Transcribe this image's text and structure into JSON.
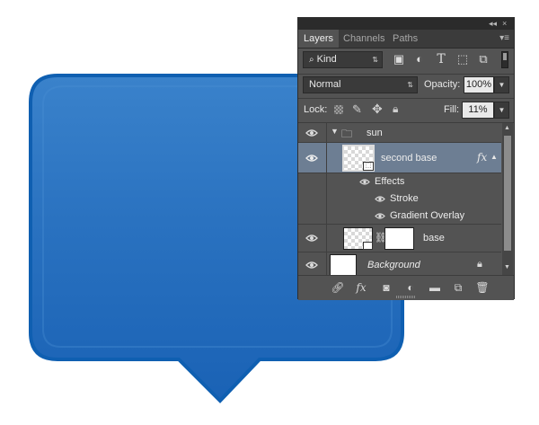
{
  "canvas": {
    "shape_colors": {
      "top": "#3a82cb",
      "mid": "#2a72c0",
      "bottom": "#1a62b5",
      "border": "#0f5fb1"
    }
  },
  "panel": {
    "titlebar": {
      "collapse_icon": "double-chevron-icon",
      "close_label": "×"
    },
    "tabs": [
      {
        "label": "Layers",
        "active": true
      },
      {
        "label": "Channels",
        "active": false
      },
      {
        "label": "Paths",
        "active": false
      }
    ],
    "menu_icon": "panel-menu-icon",
    "filter": {
      "kind_label": "Kind",
      "icons": [
        "image-filter-icon",
        "adjustment-filter-icon",
        "type-filter-icon",
        "shape-filter-icon",
        "smart-object-filter-icon"
      ]
    },
    "blend": {
      "mode": "Normal",
      "opacity_label": "Opacity:",
      "opacity_value": "100%"
    },
    "lock": {
      "label": "Lock:",
      "fill_label": "Fill:",
      "fill_value": "11%",
      "icons": [
        "lock-transparent-icon",
        "lock-paint-icon",
        "lock-position-icon",
        "lock-all-icon"
      ]
    },
    "layers": {
      "group_name": "sun",
      "second_base_name": "second base",
      "fx_label": "fx",
      "effects_label": "Effects",
      "effect_items": [
        "Stroke",
        "Gradient Overlay"
      ],
      "base_name": "base",
      "background_name": "Background"
    },
    "bottom_icons": [
      "link-icon",
      "fx-icon",
      "mask-icon",
      "adjustment-icon",
      "folder-icon",
      "new-layer-icon",
      "trash-icon"
    ],
    "bottom_fx_label": "fx"
  }
}
